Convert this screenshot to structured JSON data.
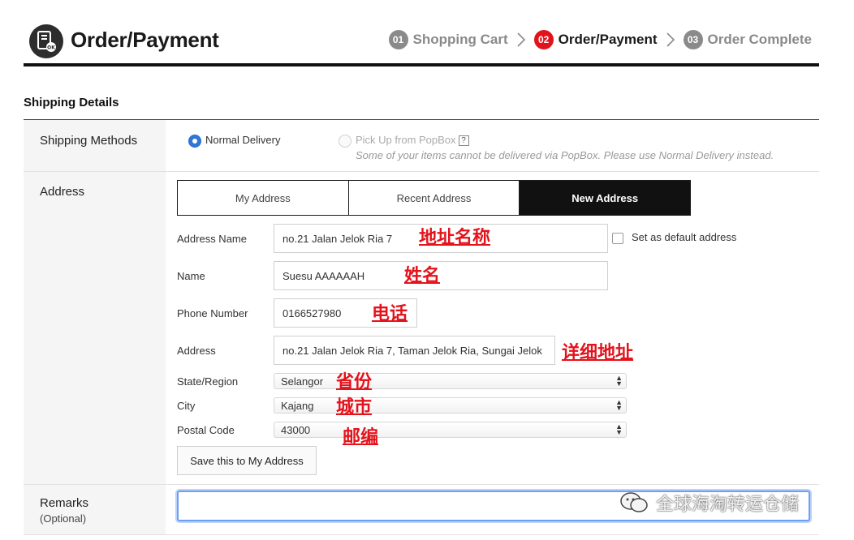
{
  "header": {
    "title": "Order/Payment",
    "steps": [
      {
        "num": "01",
        "label": "Shopping Cart"
      },
      {
        "num": "02",
        "label": "Order/Payment"
      },
      {
        "num": "03",
        "label": "Order Complete"
      }
    ],
    "active_step": "02"
  },
  "section": {
    "title": "Shipping Details"
  },
  "shipping_methods": {
    "label": "Shipping Methods",
    "option_normal": "Normal Delivery",
    "option_popbox": "Pick Up from PopBox",
    "popbox_help": "?",
    "popbox_note": "Some of your items cannot be delivered via PopBox. Please use Normal Delivery instead.",
    "selected": "Normal Delivery"
  },
  "address": {
    "label": "Address",
    "tabs": [
      "My Address",
      "Recent Address",
      "New Address"
    ],
    "active_tab": "New Address",
    "fields": {
      "address_name_label": "Address Name",
      "address_name_value": "no.21 Jalan Jelok Ria 7",
      "default_label": "Set as default address",
      "name_label": "Name",
      "name_value": "Suesu AAAAAAH",
      "phone_label": "Phone Number",
      "phone_value": "0166527980",
      "address_label": "Address",
      "address_value": "no.21 Jalan Jelok Ria 7, Taman Jelok Ria, Sungai Jelok",
      "state_label": "State/Region",
      "state_value": "Selangor",
      "city_label": "City",
      "city_value": "Kajang",
      "postal_label": "Postal Code",
      "postal_value": "43000"
    },
    "save_button": "Save this to My Address"
  },
  "annotations": {
    "address_name": "地址名称",
    "name": "姓名",
    "phone": "电话",
    "address": "详细地址",
    "state": "省份",
    "city": "城市",
    "postal": "邮编"
  },
  "remarks": {
    "label": "Remarks",
    "sub": "(Optional)",
    "value": ""
  },
  "watermark": {
    "text": "全球海淘转运仓储"
  },
  "colors": {
    "accent_red": "#e3131c",
    "radio_blue": "#2f76d6",
    "focus_blue": "#6b9ff5"
  }
}
